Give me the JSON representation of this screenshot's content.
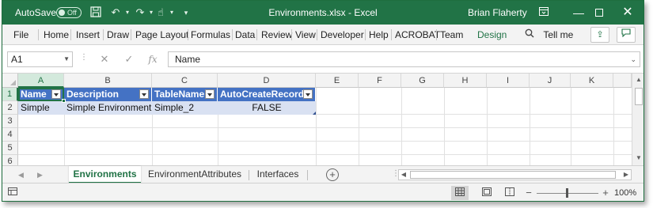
{
  "titlebar": {
    "autosave_label": "AutoSave",
    "autosave_state": "Off",
    "title": "Environments.xlsx  -  Excel",
    "user": "Brian Flaherty",
    "icons": [
      "save-icon",
      "undo-icon",
      "redo-icon",
      "touch-mode-icon",
      "customize-qat-icon",
      "ribbon-display-icon",
      "minimize-icon",
      "restore-icon",
      "close-icon"
    ]
  },
  "ribbon": {
    "tabs": [
      "File",
      "Home",
      "Insert",
      "Draw",
      "Page Layout",
      "Formulas",
      "Data",
      "Review",
      "View",
      "Developer",
      "Help",
      "ACROBAT",
      "Team",
      "Design"
    ],
    "tell_me": "Tell me"
  },
  "formula_bar": {
    "name_box": "A1",
    "formula": "Name"
  },
  "grid": {
    "columns": [
      "A",
      "B",
      "C",
      "D",
      "E",
      "F",
      "G",
      "H",
      "I",
      "J",
      "K"
    ],
    "rows": [
      "1",
      "2",
      "3",
      "4",
      "5",
      "6"
    ],
    "table_headers": [
      "Name",
      "Description",
      "TableName",
      "AutoCreateRecords"
    ],
    "table_row": [
      "Simple",
      "Simple Environment",
      "Simple_2",
      "FALSE"
    ],
    "active_cell": "A1"
  },
  "sheets": {
    "tabs": [
      "Environments",
      "EnvironmentAttributes",
      "Interfaces"
    ],
    "active": "Environments"
  },
  "status": {
    "zoom": "100%"
  },
  "colors": {
    "excel_green": "#217346",
    "table_header": "#4472c4",
    "table_row": "#d9e1f2"
  }
}
